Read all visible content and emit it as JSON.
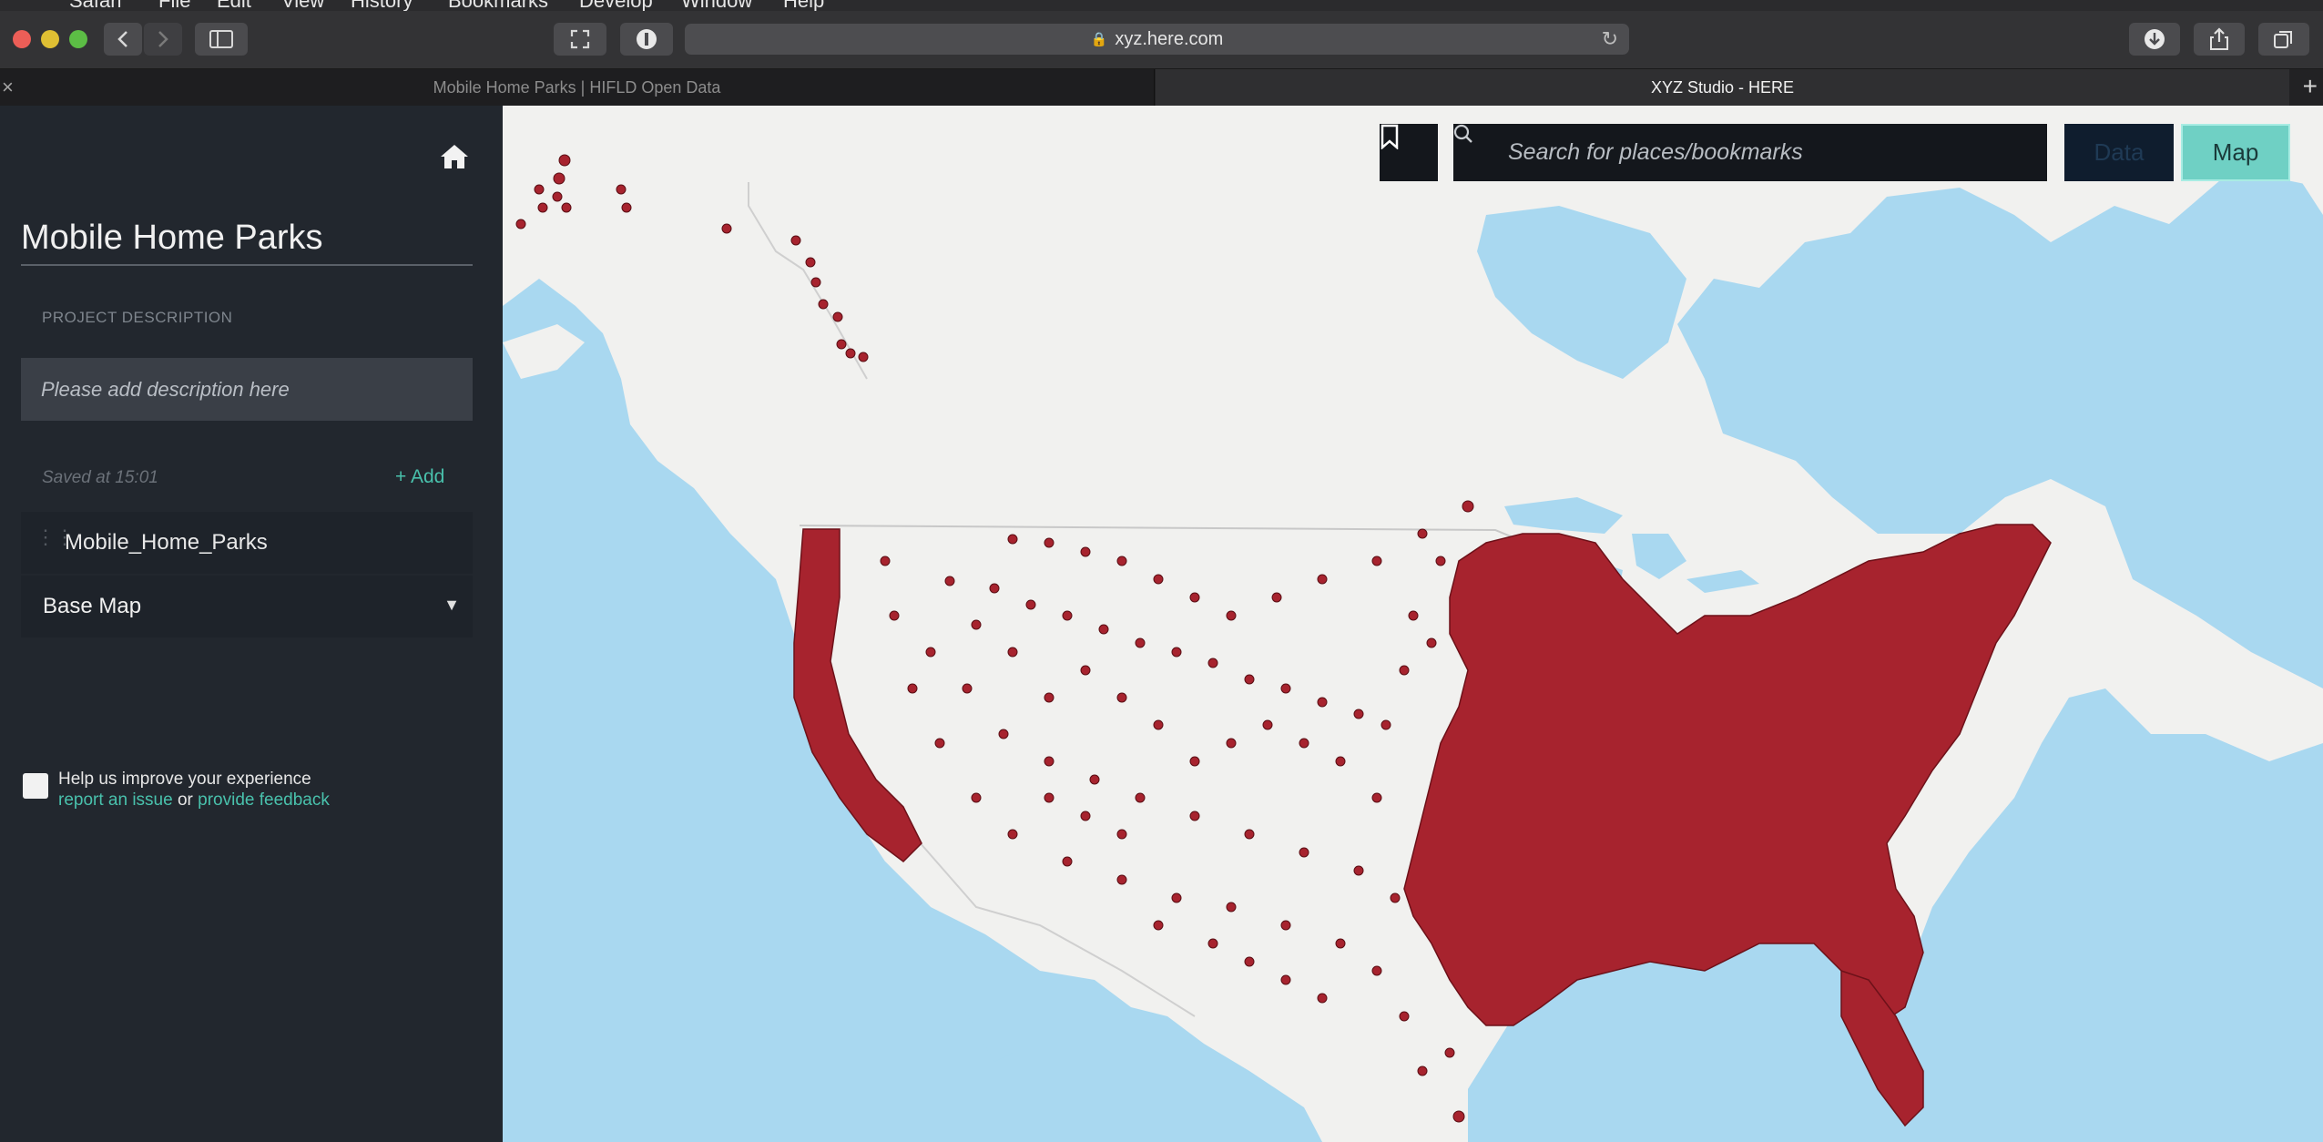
{
  "menubar": {
    "items": [
      "Safari",
      "File",
      "Edit",
      "View",
      "History",
      "Bookmarks",
      "Develop",
      "Window",
      "Help"
    ]
  },
  "browser": {
    "address": "xyz.here.com",
    "tabs": [
      {
        "label": "Mobile Home Parks | HIFLD Open Data",
        "active": false
      },
      {
        "label": "XYZ Studio - HERE",
        "active": true
      }
    ]
  },
  "sidebar": {
    "project_title": "Mobile Home Parks",
    "description_label": "PROJECT DESCRIPTION",
    "description_placeholder": "Please add description here",
    "saved_text": "Saved at 15:01",
    "add_label": "+ Add",
    "layers": [
      {
        "name": "Mobile_Home_Parks"
      }
    ],
    "basemap_label": "Base Map",
    "feedback": {
      "title": "Help us improve your experience",
      "report_link": "report an issue",
      "connector": "or",
      "feedback_link": "provide feedback"
    }
  },
  "map": {
    "search_placeholder": "Search for places/bookmarks",
    "view_toggle": {
      "data_label": "Data",
      "map_label": "Map",
      "active": "Map"
    },
    "colors": {
      "water": "#a9d8f0",
      "land": "#f1f1ef",
      "points": "#a7232e",
      "accent": "#49c1ac"
    }
  }
}
